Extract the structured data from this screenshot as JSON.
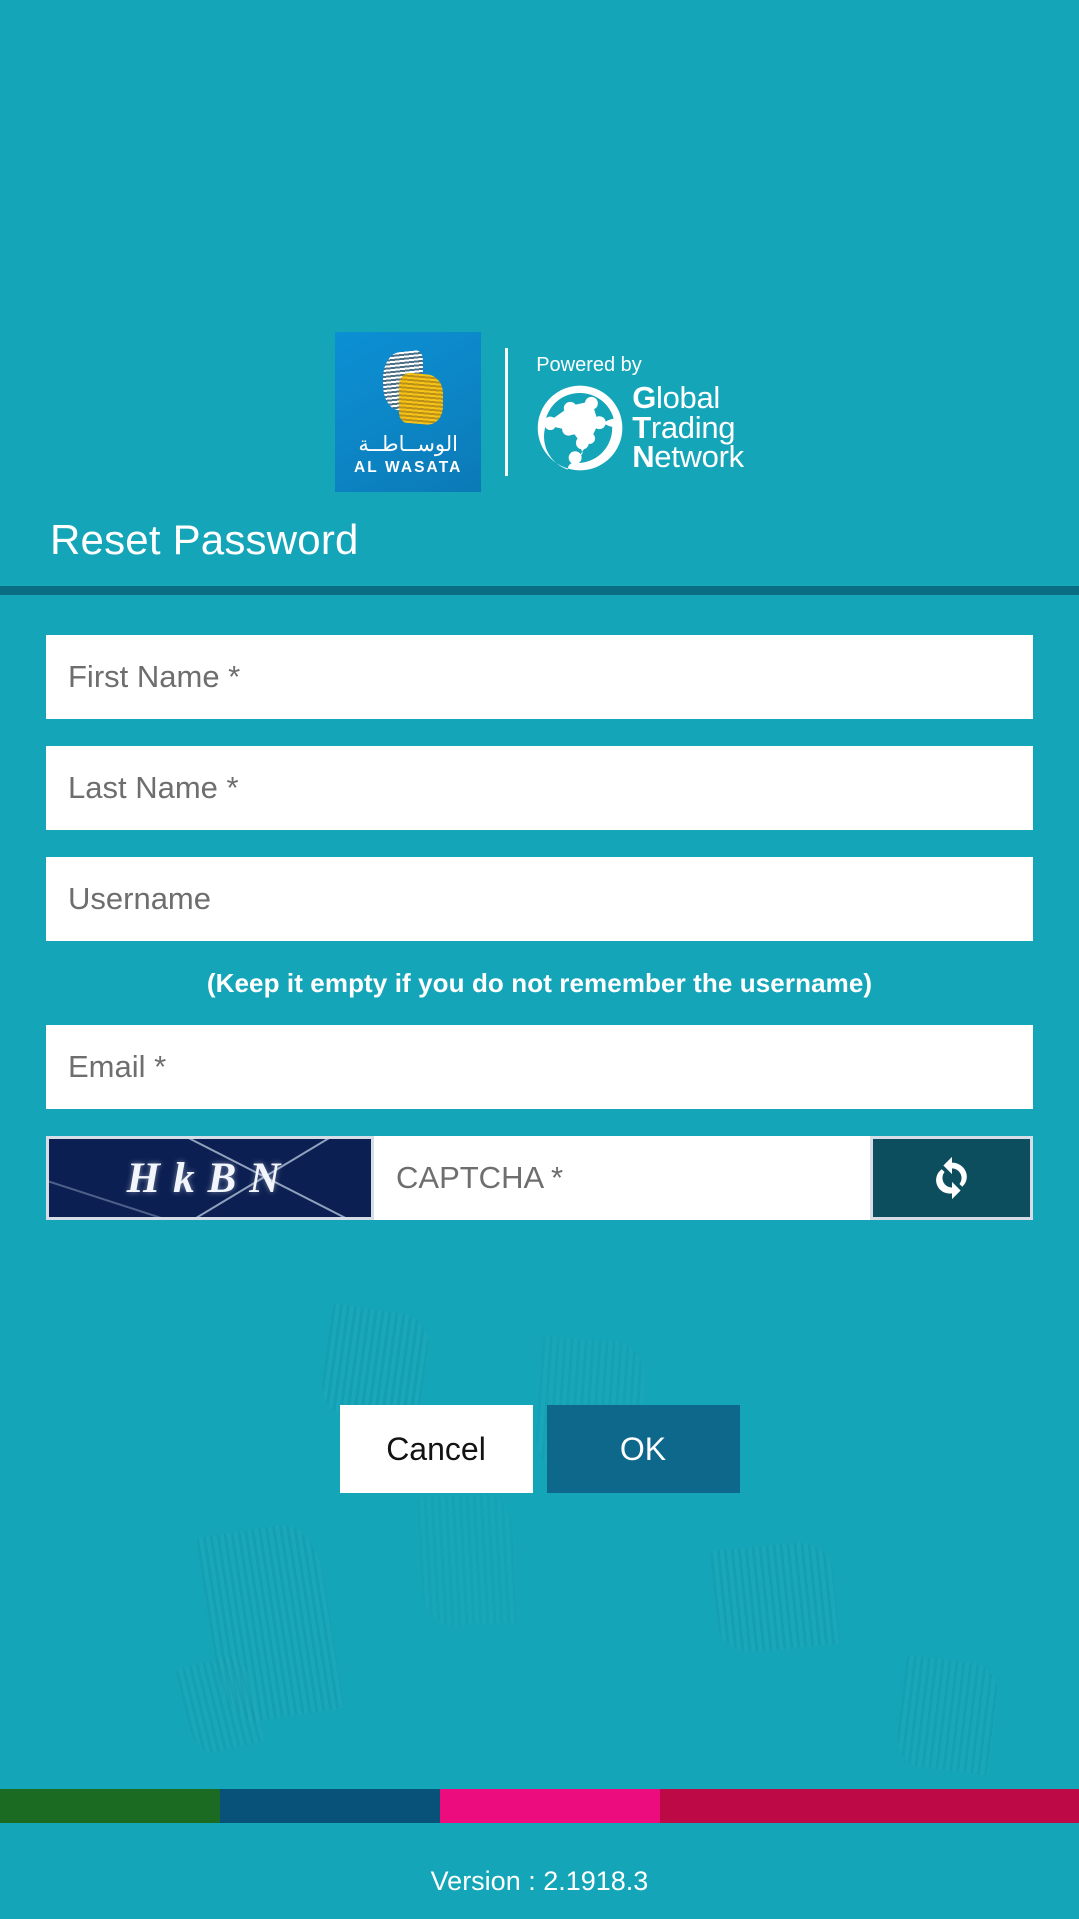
{
  "app": {
    "background_color": "#15a5b8",
    "accent_dark": "#0a6d84"
  },
  "branding": {
    "alwasata": {
      "arabic_name": "الوســاطــة",
      "latin_name": "AL WASATA",
      "box_color": "#0b87c9"
    },
    "gtn": {
      "powered_by": "Powered by",
      "line1_bold": "G",
      "line1_rest": "lobal",
      "line2_bold": "T",
      "line2_rest": "rading",
      "line3_bold": "N",
      "line3_rest": "etwork"
    }
  },
  "page": {
    "title": "Reset Password"
  },
  "form": {
    "first_name": {
      "placeholder": "First Name *",
      "value": ""
    },
    "last_name": {
      "placeholder": "Last Name *",
      "value": ""
    },
    "username": {
      "placeholder": "Username",
      "value": ""
    },
    "username_hint": "(Keep it empty if you do not remember the username)",
    "email": {
      "placeholder": "Email *",
      "value": ""
    },
    "captcha": {
      "challenge_text": "HkBN",
      "placeholder": "CAPTCHA *",
      "value": "",
      "refresh_icon": "refresh-icon",
      "image_background": "#0b1f52",
      "refresh_background": "#0c4e5e"
    }
  },
  "actions": {
    "cancel_label": "Cancel",
    "ok_label": "OK",
    "ok_color": "#0d688c"
  },
  "footer": {
    "color_bands": [
      {
        "name": "green",
        "color": "#1b6b22",
        "width_pct": 20.4
      },
      {
        "name": "blue",
        "color": "#085279",
        "width_pct": 20.4
      },
      {
        "name": "magenta",
        "color": "#ec0c7e",
        "width_pct": 20.4
      },
      {
        "name": "crimson",
        "color": "#bd0a47",
        "width_pct": 38.8
      }
    ],
    "version_text": "Version : 2.1918.3"
  }
}
